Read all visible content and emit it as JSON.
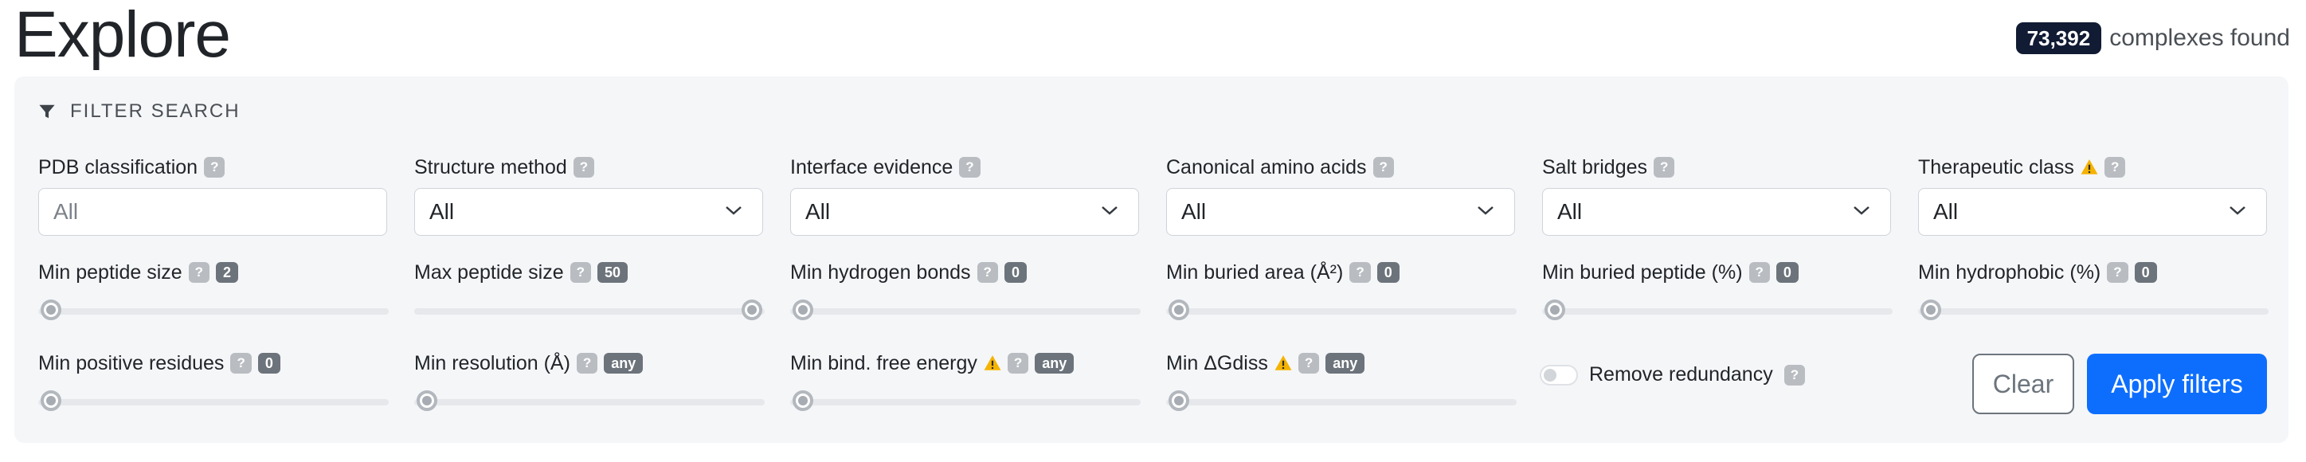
{
  "page_title": "Explore",
  "results": {
    "count": "73,392",
    "suffix": "complexes found"
  },
  "filter_header": "FILTER SEARCH",
  "help_mark": "?",
  "row1": [
    {
      "label": "PDB classification",
      "kind": "input",
      "value": "",
      "placeholder": "All",
      "warn": false
    },
    {
      "label": "Structure method",
      "kind": "select",
      "value": "All",
      "warn": false
    },
    {
      "label": "Interface evidence",
      "kind": "select",
      "value": "All",
      "warn": false
    },
    {
      "label": "Canonical amino acids",
      "kind": "select",
      "value": "All",
      "warn": false
    },
    {
      "label": "Salt bridges",
      "kind": "select",
      "value": "All",
      "warn": false
    },
    {
      "label": "Therapeutic class",
      "kind": "select",
      "value": "All",
      "warn": true
    }
  ],
  "row2": [
    {
      "label": "Min peptide size",
      "badge": "2",
      "level": 0,
      "warn": false
    },
    {
      "label": "Max peptide size",
      "badge": "50",
      "level": 1,
      "warn": false
    },
    {
      "label": "Min hydrogen bonds",
      "badge": "0",
      "level": 0,
      "warn": false
    },
    {
      "label": "Min buried area (Å²)",
      "badge": "0",
      "level": 0,
      "warn": false
    },
    {
      "label": "Min buried peptide (%)",
      "badge": "0",
      "level": 0,
      "warn": false
    },
    {
      "label": "Min hydrophobic (%)",
      "badge": "0",
      "level": 0,
      "warn": false
    }
  ],
  "row3": [
    {
      "label": "Min positive residues",
      "badge": "0",
      "level": 0,
      "warn": false
    },
    {
      "label": "Min resolution (Å)",
      "badge": "any",
      "level": 0,
      "warn": false
    },
    {
      "label": "Min bind. free energy",
      "badge": "any",
      "level": 0,
      "warn": true
    },
    {
      "label": "Min ΔGdiss",
      "badge": "any",
      "level": 0,
      "warn": true
    }
  ],
  "toggle": {
    "label": "Remove redundancy",
    "on": false
  },
  "buttons": {
    "clear": "Clear",
    "apply": "Apply filters"
  },
  "colors": {
    "primary": "#0d6efd",
    "count_badge": "#111b33",
    "warning": "#f5b301",
    "panel": "#f5f6f8"
  }
}
